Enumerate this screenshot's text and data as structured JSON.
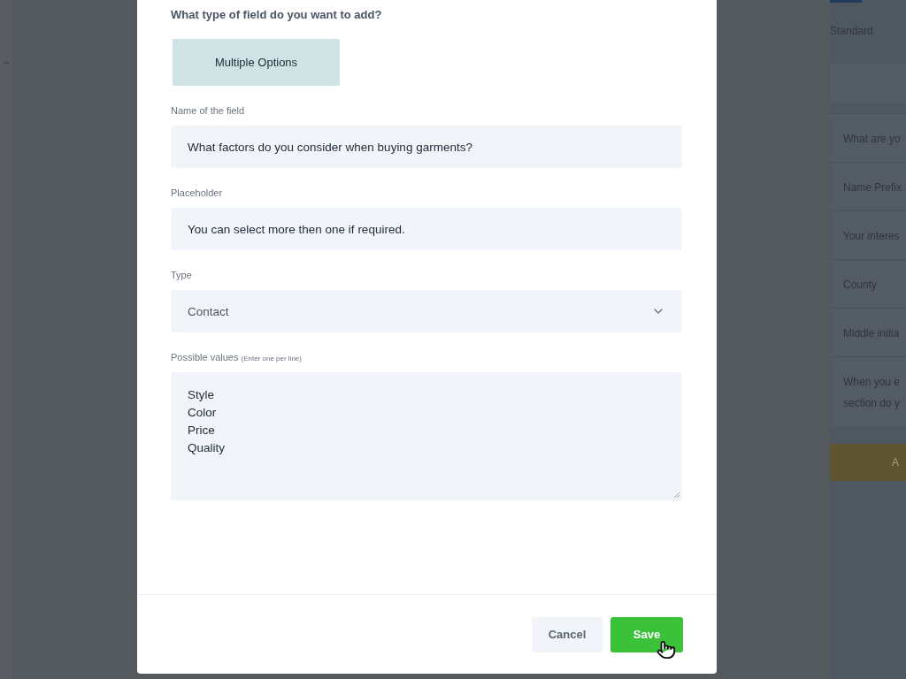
{
  "background": {
    "tab": "Standard",
    "fields": [
      "What are yo",
      "Name Prefix",
      "Your interes",
      "County",
      "Middle initia",
      "When you e\nsection do y"
    ],
    "button": "A"
  },
  "modal": {
    "question": "What type of field do you want to add?",
    "options": [
      {
        "label": "Multiple Options",
        "selected": true
      }
    ],
    "fields": [
      {
        "kind": "text",
        "label": "Name of the field",
        "value": "What factors do you consider when buying garments?"
      },
      {
        "kind": "text",
        "label": "Placeholder",
        "value": "You can select more then one if required."
      },
      {
        "kind": "select",
        "label": "Type",
        "value": "Contact"
      },
      {
        "kind": "textarea",
        "label": "Possible values",
        "hint": "(Enter one per line)",
        "value": "Style\nColor\nPrice\nQuality"
      }
    ],
    "buttons": [
      {
        "kind": "secondary",
        "label": "Cancel"
      },
      {
        "kind": "primary",
        "label": "Save"
      }
    ]
  }
}
